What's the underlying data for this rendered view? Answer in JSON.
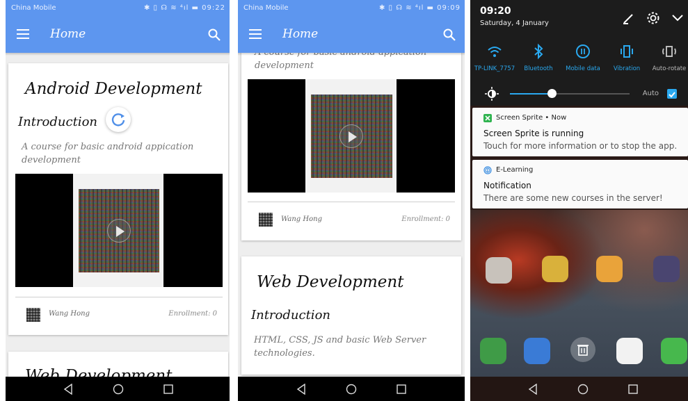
{
  "screen1": {
    "status": {
      "carrier": "China Mobile",
      "icons": "✱ ▯ ☊ ≋ ⁴ıl ▬ 09:22"
    },
    "appbar": {
      "title": "Home"
    },
    "card1": {
      "title": "Android Development",
      "section": "Introduction",
      "description": "A course for basic android appication development",
      "teacher": "Wang Hong",
      "enrollment": "Enrollment:  0"
    },
    "card2": {
      "title": "Web Development"
    }
  },
  "screen2": {
    "status": {
      "carrier": "China Mobile",
      "icons": "✱ ▯ ☊ ≋ ⁴ıl ▬ 09:09"
    },
    "appbar": {
      "title": "Home"
    },
    "card1": {
      "description_tail": "A course for basic android appication development",
      "teacher": "Wang Hong",
      "enrollment": "Enrollment:  0"
    },
    "card2": {
      "title": "Web Development",
      "section": "Introduction",
      "description": "HTML, CSS, JS and basic Web Server technologies."
    }
  },
  "screen3": {
    "time": "09:20",
    "date": "Saturday, 4 January",
    "tiles": [
      {
        "label": "TP-LINK_7757",
        "icon": "wifi-icon"
      },
      {
        "label": "Bluetooth",
        "icon": "bluetooth-icon"
      },
      {
        "label": "Mobile data",
        "icon": "mobile-data-icon"
      },
      {
        "label": "Vibration",
        "icon": "vibration-icon"
      },
      {
        "label": "Auto-rotate",
        "icon": "auto-rotate-icon"
      }
    ],
    "brightness": {
      "auto_label": "Auto",
      "level": 0.35
    },
    "notifications": [
      {
        "app": "Screen Sprite • Now",
        "title": "Screen Sprite is running",
        "text": "Touch for more information or to stop the app."
      },
      {
        "app": "E-Learning",
        "title": "Notification",
        "text": "There are some new courses in the server!"
      }
    ]
  },
  "colors": {
    "primary": "#5d96ef",
    "accent": "#2aa9f0"
  }
}
